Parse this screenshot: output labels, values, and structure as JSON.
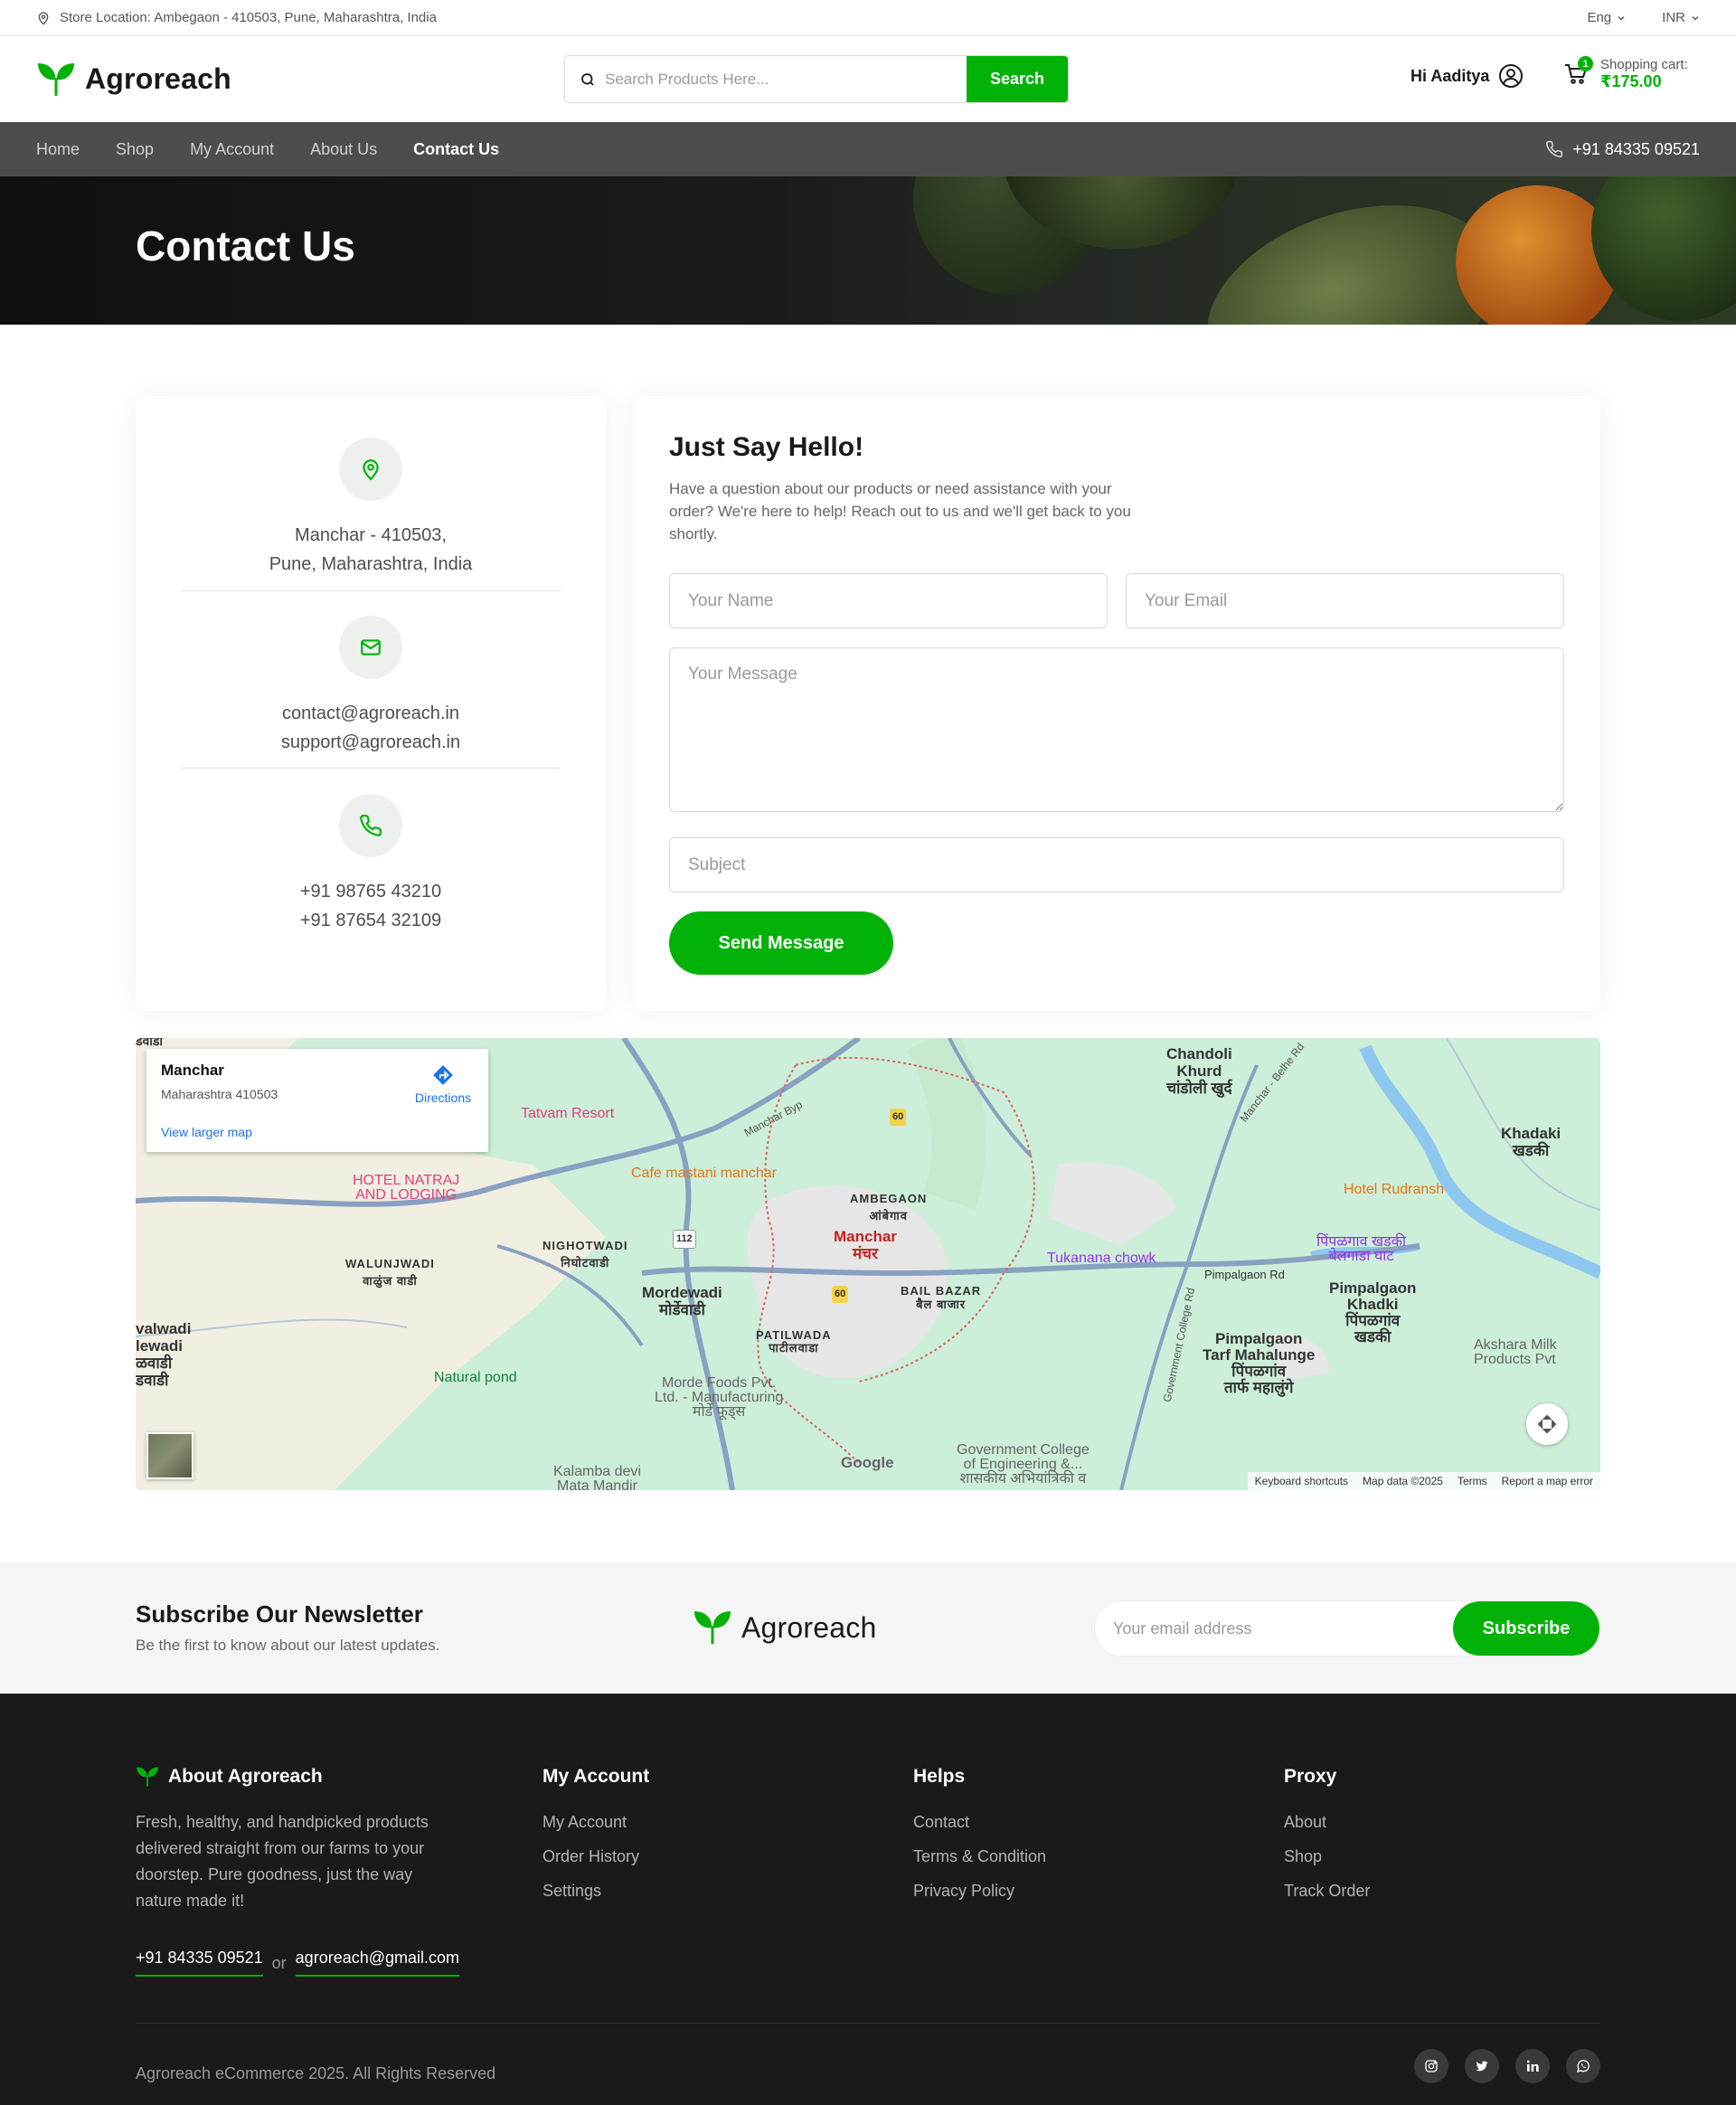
{
  "topbar": {
    "location": "Store Location: Ambegaon - 410503, Pune, Maharashtra, India",
    "language": "Eng",
    "currency": "INR"
  },
  "header": {
    "brand": "Agroreach",
    "search_placeholder": "Search Products Here...",
    "search_button": "Search",
    "greeting": "Hi Aaditya",
    "cart_count": "1",
    "cart_label": "Shopping cart:",
    "cart_total": "₹175.00"
  },
  "nav": {
    "items": [
      {
        "label": "Home"
      },
      {
        "label": "Shop"
      },
      {
        "label": "My Account"
      },
      {
        "label": "About Us"
      },
      {
        "label": "Contact Us",
        "active": true
      }
    ],
    "phone": "+91 84335 09521"
  },
  "hero": {
    "title": "Contact Us"
  },
  "contact_info": {
    "address_line1": "Manchar - 410503,",
    "address_line2": "Pune, Maharashtra, India",
    "email1": "contact@agroreach.in",
    "email2": "support@agroreach.in",
    "phone1": "+91 98765 43210",
    "phone2": "+91 87654 32109"
  },
  "form": {
    "title": "Just Say Hello!",
    "intro": "Have a question about our products or need assistance with your order? We're here to help! Reach out to us and we'll get back to you shortly.",
    "name_placeholder": "Your Name",
    "email_placeholder": "Your Email",
    "message_placeholder": "Your Message",
    "subject_placeholder": "Subject",
    "send_button": "Send Message"
  },
  "map": {
    "card_place": "Manchar",
    "card_address": "Maharashtra 410503",
    "card_larger": "View larger map",
    "card_directions": "Directions",
    "labels": {
      "chandoli": "Chandoli\nKhurd\nचांडोली खुर्द",
      "khadaki": "Khadaki\nखडकी",
      "hotel_rudransh": "Hotel Rudransh",
      "tatvam": "Tatvam Resort",
      "cafe": "Cafe mastani manchar",
      "hotel_natraj": "HOTEL NATRAJ\nAND LODGING",
      "ambegaon": "AMBEGAON\nआंबेगाव",
      "manchar": "Manchar\nमंचर",
      "nighotwadi": "NIGHOTWADI\nनिघोटवाडी",
      "walunjwadi": "WALUNJWADI\nवाळुंज वाडी",
      "mordewadi": "Mordewadi\nमोर्डेवाडी",
      "tukanana": "Tukanana chowk",
      "bail_bazar": "BAIL BAZAR\nबैल बाजार",
      "patilwada": "PATILWADA\nपाटीलवाडा",
      "pimpalgaon_rd": "Pimpalgaon Rd",
      "pimpalgaon_khadki_ghat": "पिंपळगाव खडकी\nबेलगाडा घाट",
      "pimpalgaon_khadki": "Pimpalgaon\nKhadki\nपिंपळगांव\nखडकी",
      "pimpalgaon_tarf": "Pimpalgaon\nTarf Mahalunge\nपिंपळगांव\nतार्फ महालुंगे",
      "akshara": "Akshara Milk\nProducts Pvt",
      "natural_pond": "Natural pond",
      "morde_foods": "Morde Foods Pvt.\nLtd. - Manufacturing\nमोर्डे फूड्स",
      "govt_college": "Government College\nof Engineering &...\nशासकीय अभियांत्रिकी व",
      "kalamba": "Kalamba devi\nMata Mandir",
      "manchar_byp": "Manchar Byp",
      "manchar_belhe": "Manchar - Belhe Rd",
      "govt_college_rd": "Government College Rd",
      "walwadi": "valwadi\nlewadi\nळवाडी\nडवाडी",
      "top_left": "डवाडी",
      "route_60a": "60",
      "route_60b": "60",
      "route_112": "112"
    },
    "google": "Google",
    "footer": [
      "Keyboard shortcuts",
      "Map data ©2025",
      "Terms",
      "Report a map error"
    ]
  },
  "newsletter": {
    "title": "Subscribe Our Newsletter",
    "subtitle": "Be the first to know about our latest updates.",
    "brand": "Agroreach",
    "placeholder": "Your email address",
    "button": "Subscribe"
  },
  "footer": {
    "about_title": "About Agroreach",
    "about_text": "Fresh, healthy, and handpicked products delivered straight from our farms to your doorstep. Pure goodness, just the way nature made it!",
    "phone": "+91 84335 09521",
    "or": "or",
    "email": "agroreach@gmail.com",
    "columns": [
      {
        "title": "My Account",
        "links": [
          "My Account",
          "Order History",
          "Settings"
        ]
      },
      {
        "title": "Helps",
        "links": [
          "Contact",
          "Terms & Condition",
          "Privacy Policy"
        ]
      },
      {
        "title": "Proxy",
        "links": [
          "About",
          "Shop",
          "Track Order"
        ]
      }
    ],
    "copyright": "Agroreach eCommerce 2025. All Rights Reserved",
    "socials": [
      "instagram-icon",
      "twitter-icon",
      "linkedin-icon",
      "whatsapp-icon"
    ]
  },
  "colors": {
    "accent": "#00b207",
    "nav_bg": "#4d4d4d",
    "footer_bg": "#1a1a1a"
  }
}
